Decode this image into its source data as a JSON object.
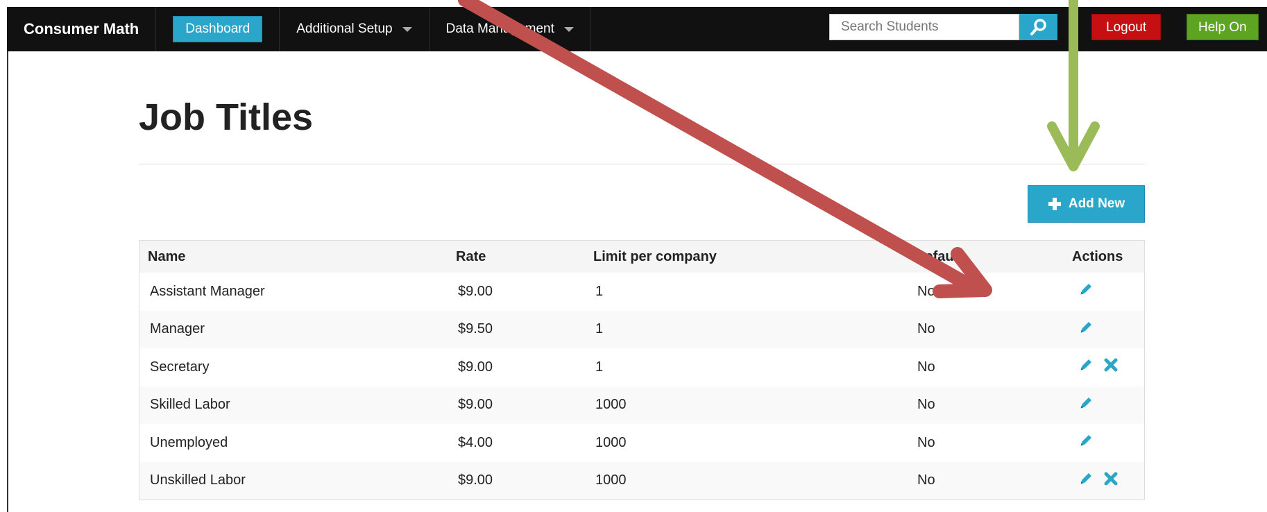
{
  "navbar": {
    "brand": "Consumer Math",
    "dashboard_label": "Dashboard",
    "menu_items": [
      {
        "label": "Additional Setup"
      },
      {
        "label": "Data Management"
      }
    ],
    "search_placeholder": "Search Students",
    "logout_label": "Logout",
    "help_label": "Help On"
  },
  "page": {
    "title": "Job Titles",
    "add_button_label": "Add New"
  },
  "table": {
    "columns": [
      "Name",
      "Rate",
      "Limit per company",
      "Default",
      "Actions"
    ],
    "rows": [
      {
        "name": "Assistant Manager",
        "rate": "$9.00",
        "limit": "1",
        "default": "No",
        "deletable": false
      },
      {
        "name": "Manager",
        "rate": "$9.50",
        "limit": "1",
        "default": "No",
        "deletable": false
      },
      {
        "name": "Secretary",
        "rate": "$9.00",
        "limit": "1",
        "default": "No",
        "deletable": true
      },
      {
        "name": "Skilled Labor",
        "rate": "$9.00",
        "limit": "1000",
        "default": "No",
        "deletable": false
      },
      {
        "name": "Unemployed",
        "rate": "$4.00",
        "limit": "1000",
        "default": "No",
        "deletable": false
      },
      {
        "name": "Unskilled Labor",
        "rate": "$9.00",
        "limit": "1000",
        "default": "No",
        "deletable": true
      }
    ]
  },
  "icons": {
    "search": "search-icon",
    "plus": "plus-icon",
    "edit": "pencil-icon",
    "delete": "x-icon",
    "caret": "caret-down-icon"
  },
  "colors": {
    "navbar_bg": "#111111",
    "primary": "#2ba6cb",
    "alert": "#c60f13",
    "success": "#5da423",
    "annotation_red": "#c0504d",
    "annotation_green": "#9bbb59"
  }
}
